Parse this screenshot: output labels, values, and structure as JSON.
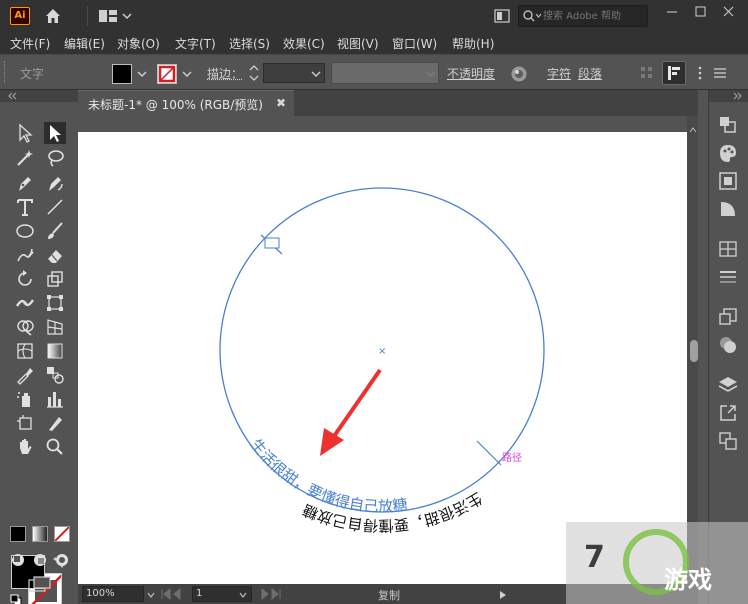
{
  "app": {
    "logo_text": "Ai"
  },
  "titlebar": {
    "search_placeholder": "搜索 Adobe 帮助",
    "icons": [
      "home-icon",
      "layout-icon",
      "arrange-icon",
      "search-icon",
      "minimize-icon",
      "maximize-icon",
      "close-icon"
    ]
  },
  "menu": [
    "文件(F)",
    "编辑(E)",
    "对象(O)",
    "文字(T)",
    "选择(S)",
    "效果(C)",
    "视图(V)",
    "窗口(W)",
    "帮助(H)"
  ],
  "control": {
    "object_label": "文字",
    "stroke_label": "描边：",
    "opacity_label": "不透明度",
    "char_label": "字符",
    "para_label": "段落",
    "fill_color": "#000000",
    "stroke_color": "none"
  },
  "document": {
    "tab_title": "未标题-1* @ 100% (RGB/预览)",
    "tab_close": "✖"
  },
  "canvas": {
    "path_text_inner": "生活很甜，要懂得自己放糖",
    "path_text_outer": "生活很甜，要懂得自己放糖",
    "path_label": "路径",
    "center_mark": "×",
    "circle_color": "#4a7fd4",
    "arrow_color": "#ee3030",
    "label_color": "#e040e0"
  },
  "status": {
    "zoom": "100%",
    "page": "1",
    "action": "复制"
  },
  "watermark": {
    "brand": "游戏",
    "number": "7"
  }
}
